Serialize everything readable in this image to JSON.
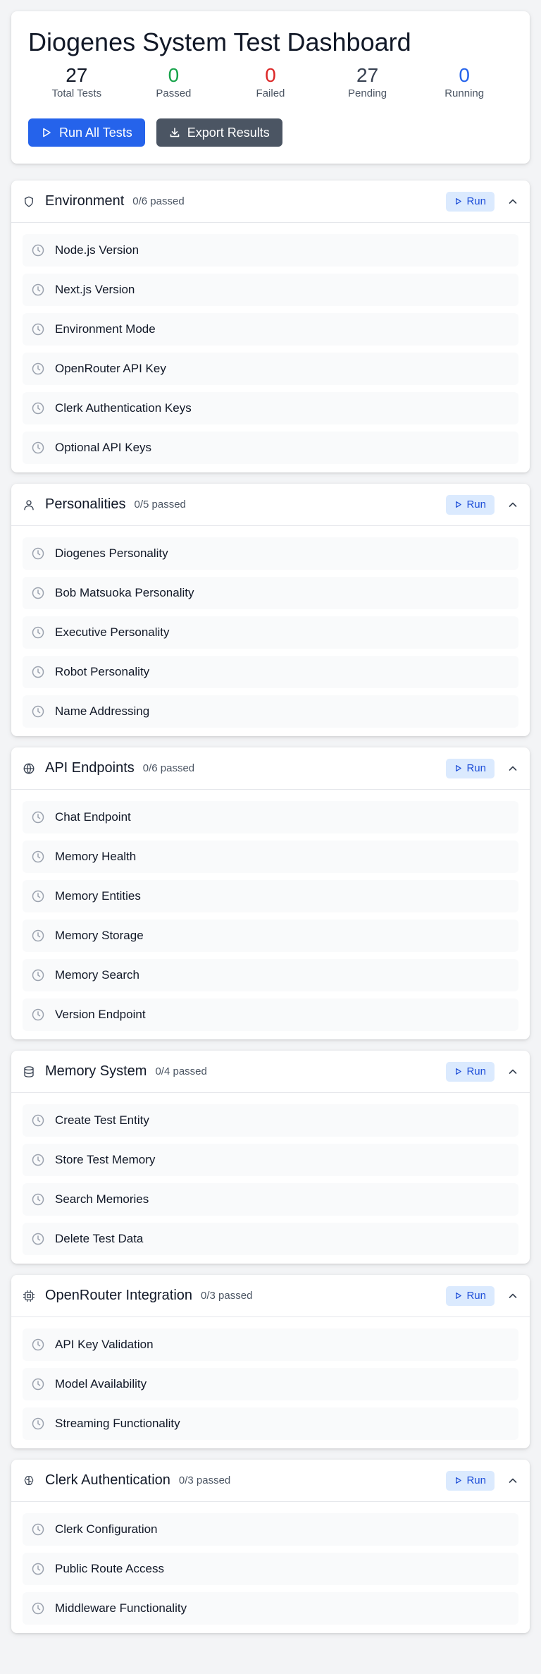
{
  "header": {
    "title": "Diogenes System Test Dashboard",
    "stats": [
      {
        "value": "27",
        "label": "Total Tests",
        "color": "#111827"
      },
      {
        "value": "0",
        "label": "Passed",
        "color": "#16a34a"
      },
      {
        "value": "0",
        "label": "Failed",
        "color": "#dc2626"
      },
      {
        "value": "27",
        "label": "Pending",
        "color": "#374151"
      },
      {
        "value": "0",
        "label": "Running",
        "color": "#2563eb"
      }
    ],
    "run_all_label": "Run All Tests",
    "export_label": "Export Results"
  },
  "run_label": "Run",
  "sections": [
    {
      "icon": "shield-icon",
      "title": "Environment",
      "count": "0/6 passed",
      "tests": [
        "Node.js Version",
        "Next.js Version",
        "Environment Mode",
        "OpenRouter API Key",
        "Clerk Authentication Keys",
        "Optional API Keys"
      ]
    },
    {
      "icon": "user-icon",
      "title": "Personalities",
      "count": "0/5 passed",
      "tests": [
        "Diogenes Personality",
        "Bob Matsuoka Personality",
        "Executive Personality",
        "Robot Personality",
        "Name Addressing"
      ]
    },
    {
      "icon": "globe-icon",
      "title": "API Endpoints",
      "count": "0/6 passed",
      "tests": [
        "Chat Endpoint",
        "Memory Health",
        "Memory Entities",
        "Memory Storage",
        "Memory Search",
        "Version Endpoint"
      ]
    },
    {
      "icon": "database-icon",
      "title": "Memory System",
      "count": "0/4 passed",
      "tests": [
        "Create Test Entity",
        "Store Test Memory",
        "Search Memories",
        "Delete Test Data"
      ]
    },
    {
      "icon": "cpu-icon",
      "title": "OpenRouter Integration",
      "count": "0/3 passed",
      "tests": [
        "API Key Validation",
        "Model Availability",
        "Streaming Functionality"
      ]
    },
    {
      "icon": "brain-icon",
      "title": "Clerk Authentication",
      "count": "0/3 passed",
      "tests": [
        "Clerk Configuration",
        "Public Route Access",
        "Middleware Functionality"
      ]
    }
  ],
  "colors": {
    "accent": "#2563eb",
    "run_badge_bg": "#dbeafe",
    "run_badge_text": "#1d4ed8",
    "pending_icon": "#9ca3af"
  }
}
